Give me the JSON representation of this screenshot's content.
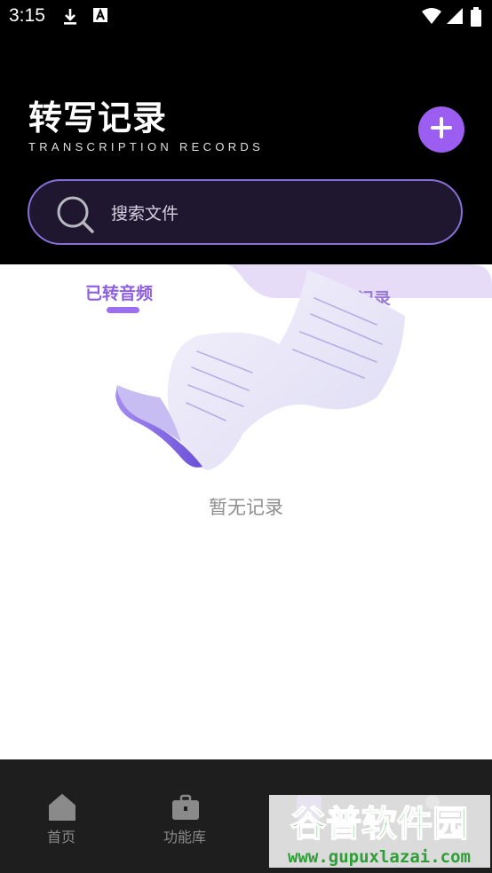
{
  "status_bar": {
    "time": "3:15",
    "left_icons": [
      "download-icon",
      "font-a-icon"
    ],
    "right_icons": [
      "wifi-icon",
      "signal-icon",
      "battery-icon"
    ]
  },
  "header": {
    "title": "转写记录",
    "subtitle": "TRANSCRIPTION RECORDS",
    "add_icon": "plus-icon",
    "accent_color": "#9b5ef0"
  },
  "search": {
    "placeholder": "搜索文件",
    "icon": "search-icon"
  },
  "tabs": [
    {
      "label": "已转音频",
      "active": true
    },
    {
      "label": "转写记录",
      "active": false
    }
  ],
  "empty_state": {
    "icon": "document-scroll-illustration",
    "message": "暂无记录"
  },
  "bottom_nav": {
    "items": [
      {
        "label": "首页",
        "icon": "home-icon"
      },
      {
        "label": "功能库",
        "icon": "briefcase-icon"
      },
      {
        "label": "",
        "icon": "transcribe-icon",
        "active": true
      },
      {
        "label": "",
        "icon": "profile-icon"
      }
    ]
  },
  "watermark": {
    "name": "谷普软件园",
    "url": "www.gupuxlazai.com"
  }
}
